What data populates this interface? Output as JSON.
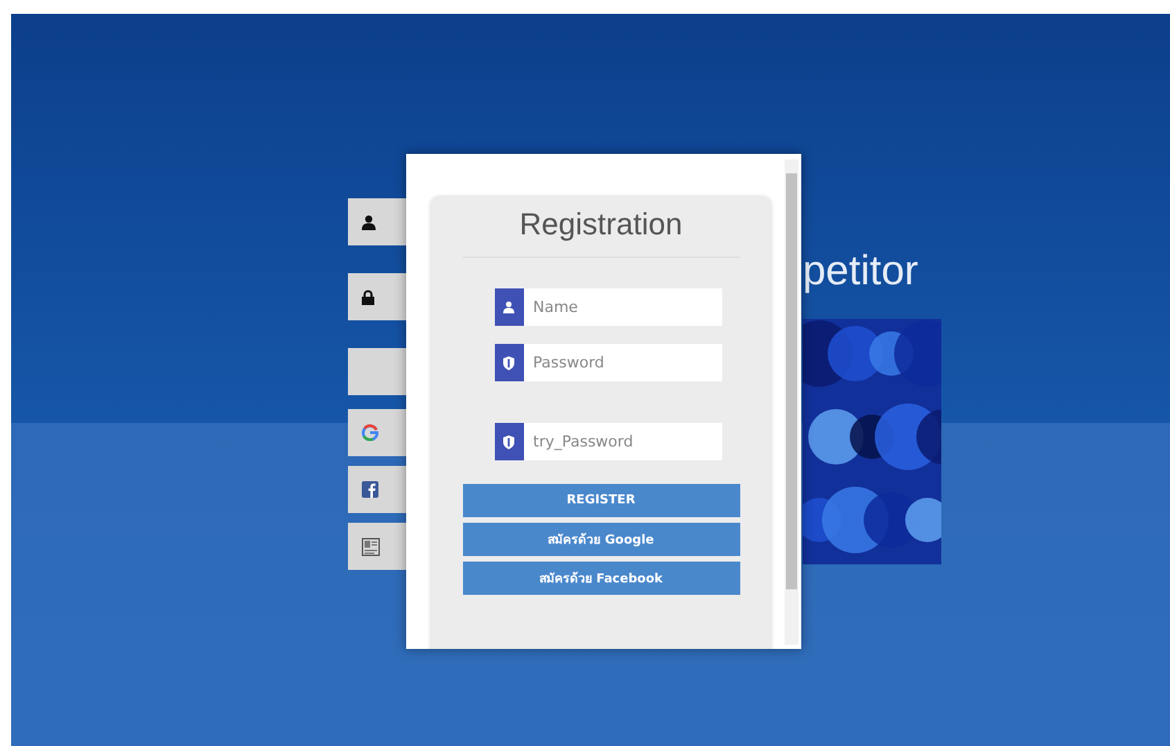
{
  "background": {
    "side_buttons": [
      {
        "kind": "user"
      },
      {
        "kind": "lock"
      },
      {
        "kind": "blank"
      },
      {
        "kind": "google"
      },
      {
        "kind": "facebook"
      },
      {
        "kind": "card"
      }
    ],
    "heading": "petitor"
  },
  "dialog": {
    "title": "Registration",
    "fields": [
      {
        "kind": "user",
        "placeholder": "Name"
      },
      {
        "kind": "shield",
        "placeholder": "Password"
      },
      {
        "kind": "shield",
        "placeholder": "try_Password"
      }
    ],
    "buttons": [
      "REGISTER",
      "สมัครด้วย Google",
      "สมัครด้วย Facebook"
    ]
  }
}
